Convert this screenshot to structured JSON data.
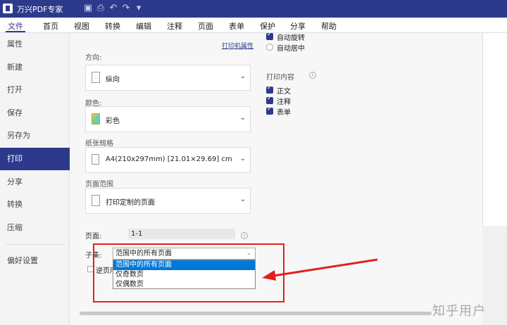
{
  "app": {
    "title": "万兴PDF专家"
  },
  "toolbar": {
    "icons": [
      "save-icon",
      "print-icon",
      "undo-icon",
      "redo-icon",
      "dropdown-icon"
    ]
  },
  "menu": [
    "文件",
    "首页",
    "视图",
    "转换",
    "编辑",
    "注释",
    "页面",
    "表单",
    "保护",
    "分享",
    "帮助"
  ],
  "sidebar": {
    "items": [
      "属性",
      "新建",
      "打开",
      "保存",
      "另存为",
      "打印",
      "分享",
      "转换",
      "压缩",
      "偏好设置"
    ],
    "active": "打印"
  },
  "print": {
    "printer_props_link": "打印机属性",
    "auto_rotate": {
      "label": "自动旋转",
      "checked": true
    },
    "auto_center": {
      "label": "自动居中",
      "checked": false
    },
    "orientation": {
      "label": "方向:",
      "value": "纵向"
    },
    "color": {
      "label": "颜色:",
      "value": "彩色"
    },
    "paper": {
      "label": "纸张规格",
      "value": "A4(210x297mm) [21.01×29.69] cm"
    },
    "range": {
      "label": "页面范围",
      "value": "打印定制的页面"
    },
    "content": {
      "title": "打印内容",
      "items": [
        {
          "label": "正文",
          "checked": true
        },
        {
          "label": "注释",
          "checked": true
        },
        {
          "label": "表单",
          "checked": true
        }
      ]
    },
    "pages": {
      "label": "页面:",
      "value": "1-1"
    },
    "subset": {
      "label": "子集:",
      "value": "范围中的所有页面",
      "options": [
        "范围中的所有页面",
        "仅奇数页",
        "仅偶数页"
      ],
      "highlighted": "范围中的所有页面"
    },
    "reverse": {
      "label": "逆页序"
    }
  },
  "watermark": "知乎用户",
  "colors": {
    "brand": "#2d3a8c",
    "highlight": "#0078d7",
    "annotation": "#e02020"
  }
}
